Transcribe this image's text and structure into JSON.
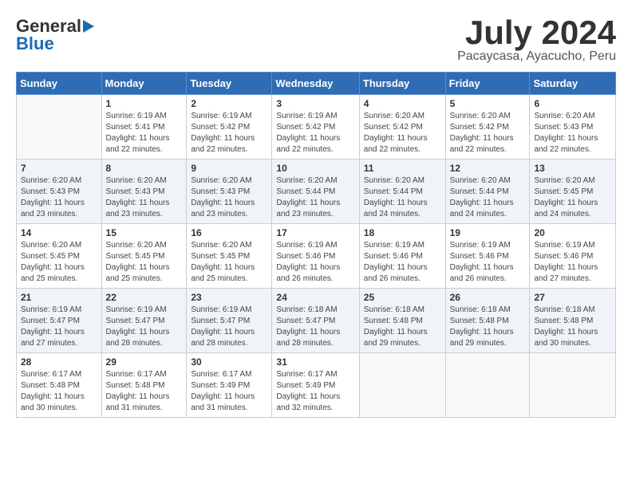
{
  "header": {
    "logo_general": "General",
    "logo_blue": "Blue",
    "month_year": "July 2024",
    "location": "Pacaycasa, Ayacucho, Peru"
  },
  "days_of_week": [
    "Sunday",
    "Monday",
    "Tuesday",
    "Wednesday",
    "Thursday",
    "Friday",
    "Saturday"
  ],
  "weeks": [
    [
      {
        "day": "",
        "info": ""
      },
      {
        "day": "1",
        "info": "Sunrise: 6:19 AM\nSunset: 5:41 PM\nDaylight: 11 hours\nand 22 minutes."
      },
      {
        "day": "2",
        "info": "Sunrise: 6:19 AM\nSunset: 5:42 PM\nDaylight: 11 hours\nand 22 minutes."
      },
      {
        "day": "3",
        "info": "Sunrise: 6:19 AM\nSunset: 5:42 PM\nDaylight: 11 hours\nand 22 minutes."
      },
      {
        "day": "4",
        "info": "Sunrise: 6:20 AM\nSunset: 5:42 PM\nDaylight: 11 hours\nand 22 minutes."
      },
      {
        "day": "5",
        "info": "Sunrise: 6:20 AM\nSunset: 5:42 PM\nDaylight: 11 hours\nand 22 minutes."
      },
      {
        "day": "6",
        "info": "Sunrise: 6:20 AM\nSunset: 5:43 PM\nDaylight: 11 hours\nand 22 minutes."
      }
    ],
    [
      {
        "day": "7",
        "info": "Sunrise: 6:20 AM\nSunset: 5:43 PM\nDaylight: 11 hours\nand 23 minutes."
      },
      {
        "day": "8",
        "info": "Sunrise: 6:20 AM\nSunset: 5:43 PM\nDaylight: 11 hours\nand 23 minutes."
      },
      {
        "day": "9",
        "info": "Sunrise: 6:20 AM\nSunset: 5:43 PM\nDaylight: 11 hours\nand 23 minutes."
      },
      {
        "day": "10",
        "info": "Sunrise: 6:20 AM\nSunset: 5:44 PM\nDaylight: 11 hours\nand 23 minutes."
      },
      {
        "day": "11",
        "info": "Sunrise: 6:20 AM\nSunset: 5:44 PM\nDaylight: 11 hours\nand 24 minutes."
      },
      {
        "day": "12",
        "info": "Sunrise: 6:20 AM\nSunset: 5:44 PM\nDaylight: 11 hours\nand 24 minutes."
      },
      {
        "day": "13",
        "info": "Sunrise: 6:20 AM\nSunset: 5:45 PM\nDaylight: 11 hours\nand 24 minutes."
      }
    ],
    [
      {
        "day": "14",
        "info": "Sunrise: 6:20 AM\nSunset: 5:45 PM\nDaylight: 11 hours\nand 25 minutes."
      },
      {
        "day": "15",
        "info": "Sunrise: 6:20 AM\nSunset: 5:45 PM\nDaylight: 11 hours\nand 25 minutes."
      },
      {
        "day": "16",
        "info": "Sunrise: 6:20 AM\nSunset: 5:45 PM\nDaylight: 11 hours\nand 25 minutes."
      },
      {
        "day": "17",
        "info": "Sunrise: 6:19 AM\nSunset: 5:46 PM\nDaylight: 11 hours\nand 26 minutes."
      },
      {
        "day": "18",
        "info": "Sunrise: 6:19 AM\nSunset: 5:46 PM\nDaylight: 11 hours\nand 26 minutes."
      },
      {
        "day": "19",
        "info": "Sunrise: 6:19 AM\nSunset: 5:46 PM\nDaylight: 11 hours\nand 26 minutes."
      },
      {
        "day": "20",
        "info": "Sunrise: 6:19 AM\nSunset: 5:46 PM\nDaylight: 11 hours\nand 27 minutes."
      }
    ],
    [
      {
        "day": "21",
        "info": "Sunrise: 6:19 AM\nSunset: 5:47 PM\nDaylight: 11 hours\nand 27 minutes."
      },
      {
        "day": "22",
        "info": "Sunrise: 6:19 AM\nSunset: 5:47 PM\nDaylight: 11 hours\nand 28 minutes."
      },
      {
        "day": "23",
        "info": "Sunrise: 6:19 AM\nSunset: 5:47 PM\nDaylight: 11 hours\nand 28 minutes."
      },
      {
        "day": "24",
        "info": "Sunrise: 6:18 AM\nSunset: 5:47 PM\nDaylight: 11 hours\nand 28 minutes."
      },
      {
        "day": "25",
        "info": "Sunrise: 6:18 AM\nSunset: 5:48 PM\nDaylight: 11 hours\nand 29 minutes."
      },
      {
        "day": "26",
        "info": "Sunrise: 6:18 AM\nSunset: 5:48 PM\nDaylight: 11 hours\nand 29 minutes."
      },
      {
        "day": "27",
        "info": "Sunrise: 6:18 AM\nSunset: 5:48 PM\nDaylight: 11 hours\nand 30 minutes."
      }
    ],
    [
      {
        "day": "28",
        "info": "Sunrise: 6:17 AM\nSunset: 5:48 PM\nDaylight: 11 hours\nand 30 minutes."
      },
      {
        "day": "29",
        "info": "Sunrise: 6:17 AM\nSunset: 5:48 PM\nDaylight: 11 hours\nand 31 minutes."
      },
      {
        "day": "30",
        "info": "Sunrise: 6:17 AM\nSunset: 5:49 PM\nDaylight: 11 hours\nand 31 minutes."
      },
      {
        "day": "31",
        "info": "Sunrise: 6:17 AM\nSunset: 5:49 PM\nDaylight: 11 hours\nand 32 minutes."
      },
      {
        "day": "",
        "info": ""
      },
      {
        "day": "",
        "info": ""
      },
      {
        "day": "",
        "info": ""
      }
    ]
  ]
}
